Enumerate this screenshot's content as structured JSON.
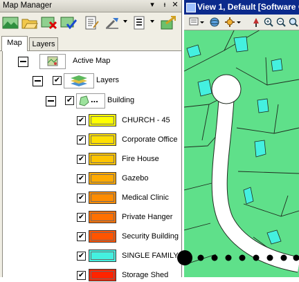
{
  "map_manager": {
    "title": "Map Manager",
    "title_pin": "❒",
    "title_close": "✕",
    "toolbar": {
      "buttons": [
        "new-map-icon",
        "open-map-icon",
        "delete-map-icon",
        "validate-map-icon",
        "properties-icon",
        "tools-icon",
        "list-icon",
        "export-icon"
      ]
    },
    "tabs": [
      {
        "label": "Map"
      },
      {
        "label": "Layers"
      }
    ],
    "tree": {
      "active_map": "Active Map",
      "layers": "Layers",
      "building": "Building",
      "building_more": "...",
      "items": [
        {
          "label": "CHURCH - 45",
          "color": "#ffff00"
        },
        {
          "label": "Corporate Office",
          "color": "#ffe000"
        },
        {
          "label": "Fire House",
          "color": "#ffc400"
        },
        {
          "label": "Gazebo",
          "color": "#ffaa00"
        },
        {
          "label": "Medical Clinic",
          "color": "#ff8c00"
        },
        {
          "label": "Private Hanger",
          "color": "#ff7000"
        },
        {
          "label": "Security Building",
          "color": "#ff5400"
        },
        {
          "label": "SINGLE FAMILY",
          "color": "#44f0e0"
        },
        {
          "label": "Storage Shed",
          "color": "#ff2400"
        }
      ],
      "checked": "✔"
    }
  },
  "view": {
    "title": "View 1, Default [Software G",
    "toolbar_icons": [
      "select-icon",
      "globe-icon",
      "settings-icon",
      "pin-icon",
      "zoom-in-icon",
      "zoom-out-icon",
      "zoom-box-icon"
    ],
    "colors": {
      "land": "#5fe08a",
      "building": "#44f0e0",
      "road": "#ffffff"
    }
  },
  "annotation": {
    "color": "#000000"
  }
}
